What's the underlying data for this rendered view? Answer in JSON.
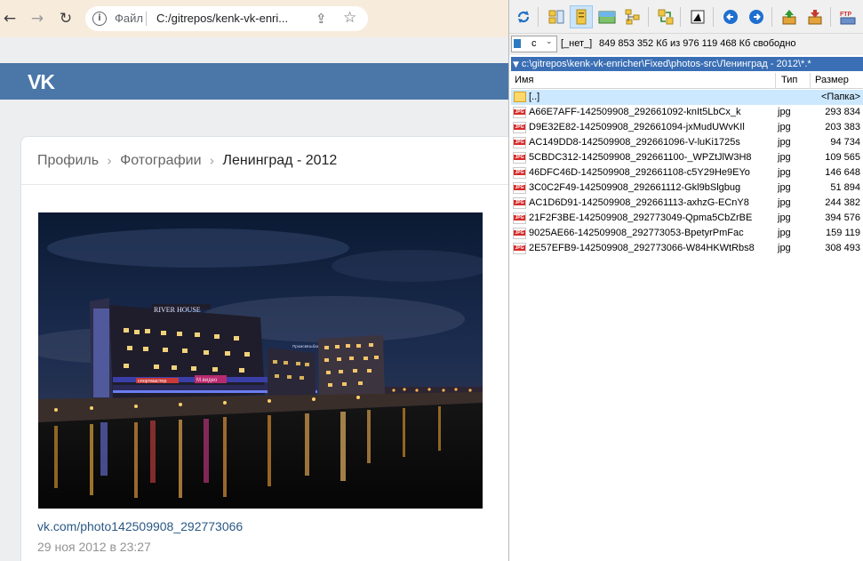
{
  "browser": {
    "omnibox": {
      "scheme": "Файл",
      "url": "C:/gitrepos/kenk-vk-enri..."
    }
  },
  "vk": {
    "logo": "VK",
    "breadcrumb": {
      "profile": "Профиль",
      "photos": "Фотографии",
      "album": "Ленинград - 2012",
      "separator": "›"
    },
    "photo": {
      "signs": [
        "RIVER HOUSE",
        "спортмастер",
        "М.видео",
        "Промсвязьбанк"
      ],
      "link": "vk.com/photo142509908_292773066",
      "date": "29 ноя 2012 в 23:27"
    }
  },
  "file_manager": {
    "toolbar_icons": [
      "refresh-icon",
      "brief-view-icon",
      "full-view-icon",
      "thumbnails-icon",
      "tree-icon",
      "compare-icon",
      "quick-view-icon",
      "back-icon",
      "forward-icon",
      "pack-icon",
      "unpack-icon",
      "ftp-icon"
    ],
    "ftp_label": "FTP",
    "drive": {
      "letter": "c",
      "label": "[_нет_]",
      "free_space": "849 853 352 Кб из 976 119 468 Кб свободно"
    },
    "path": "c:\\gitrepos\\kenk-vk-enricher\\Fixed\\photos-src\\Ленинград - 2012\\*.*",
    "columns": {
      "name": "Имя",
      "type": "Тип",
      "size": "Размер"
    },
    "parent_row": {
      "name": "[..]",
      "type": "",
      "size": "<Папка>"
    },
    "files": [
      {
        "name": "A66E7AFF-142509908_292661092-knIt5LbCx_k",
        "type": "jpg",
        "size": "293 834"
      },
      {
        "name": "D9E32E82-142509908_292661094-jxMudUWvKIl",
        "type": "jpg",
        "size": "203 383"
      },
      {
        "name": "AC149DD8-142509908_292661096-V-luKi1725s",
        "type": "jpg",
        "size": "94 734"
      },
      {
        "name": "5CBDC312-142509908_292661100-_WPZtJlW3H8",
        "type": "jpg",
        "size": "109 565"
      },
      {
        "name": "46DFC46D-142509908_292661108-c5Y29He9EYo",
        "type": "jpg",
        "size": "146 648"
      },
      {
        "name": "3C0C2F49-142509908_292661112-Gkl9bSlgbug",
        "type": "jpg",
        "size": "51 894"
      },
      {
        "name": "AC1D6D91-142509908_292661113-axhzG-ECnY8",
        "type": "jpg",
        "size": "244 382"
      },
      {
        "name": "21F2F3BE-142509908_292773049-Qpma5CbZrBE",
        "type": "jpg",
        "size": "394 576"
      },
      {
        "name": "9025AE66-142509908_292773053-BpetyrPmFac",
        "type": "jpg",
        "size": "159 119"
      },
      {
        "name": "2E57EFB9-142509908_292773066-W84HKWtRbs8",
        "type": "jpg",
        "size": "308 493"
      }
    ]
  },
  "colors": {
    "vk_header": "#4a76a8",
    "vk_link": "#2a5885",
    "fm_path_bar": "#3a6fb5",
    "selection": "#cce8ff",
    "chrome_frame": "#f7ebdc"
  }
}
